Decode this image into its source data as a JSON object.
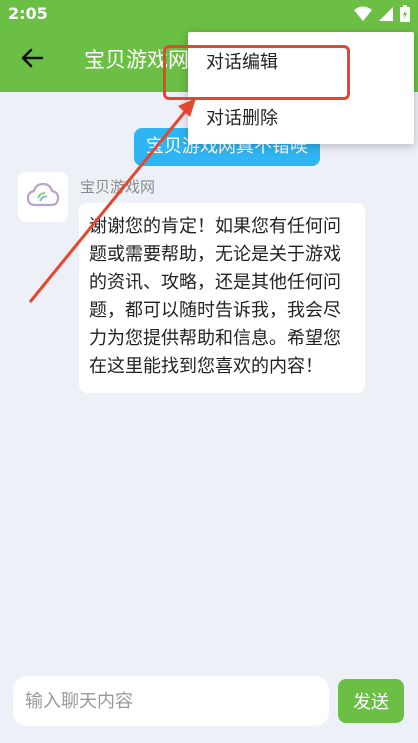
{
  "status_bar": {
    "time": "2:05",
    "icons": [
      "wifi-icon",
      "signal-icon",
      "battery-icon"
    ]
  },
  "header": {
    "title": "宝贝游戏网",
    "back_icon": "back-arrow-icon"
  },
  "context_menu": {
    "items": [
      {
        "label": "对话编辑"
      },
      {
        "label": "对话删除"
      }
    ]
  },
  "chat": {
    "user_message": "宝贝游戏网真不错唉",
    "bot": {
      "name": "宝贝游戏网",
      "avatar_icon": "cloud-logo-icon",
      "message": "谢谢您的肯定！如果您有任何问题或需要帮助，无论是关于游戏的资讯、攻略，还是其他任何问题，都可以随时告诉我，我会尽力为您提供帮助和信息。希望您在这里能找到您喜欢的内容！"
    }
  },
  "input_bar": {
    "placeholder": "输入聊天内容",
    "value": "",
    "send_label": "发送"
  },
  "colors": {
    "brand": "#6cbf45",
    "user_bubble": "#2fb5f3",
    "annotation": "#e8452f",
    "background": "#eef0f7"
  }
}
